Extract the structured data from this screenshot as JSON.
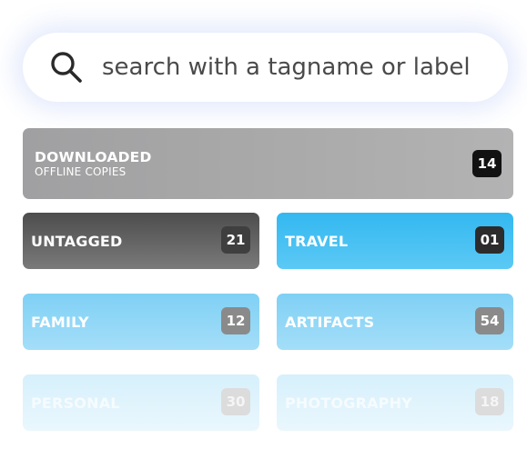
{
  "search": {
    "placeholder": "search with a tagname or label",
    "icon": "search-icon"
  },
  "colors": {
    "downloaded": "#a9a9aa",
    "untagged": "#6b6b6b",
    "travel": "#3ebcf1",
    "family": "#8cd5f6",
    "artifacts": "#8cd5f6",
    "faded": "#e3f5fd"
  },
  "tags": {
    "downloaded": {
      "label": "DOWNLOADED",
      "sublabel": "OFFLINE COPIES",
      "count": "14"
    },
    "untagged": {
      "label": "UNTAGGED",
      "count": "21"
    },
    "travel": {
      "label": "TRAVEL",
      "count": "01"
    },
    "family": {
      "label": "FAMILY",
      "count": "12"
    },
    "artifacts": {
      "label": "ARTIFACTS",
      "count": "54"
    },
    "personal": {
      "label": "PERSONAL",
      "count": "30"
    },
    "photography": {
      "label": "PHOTOGRAPHY",
      "count": "18"
    }
  }
}
